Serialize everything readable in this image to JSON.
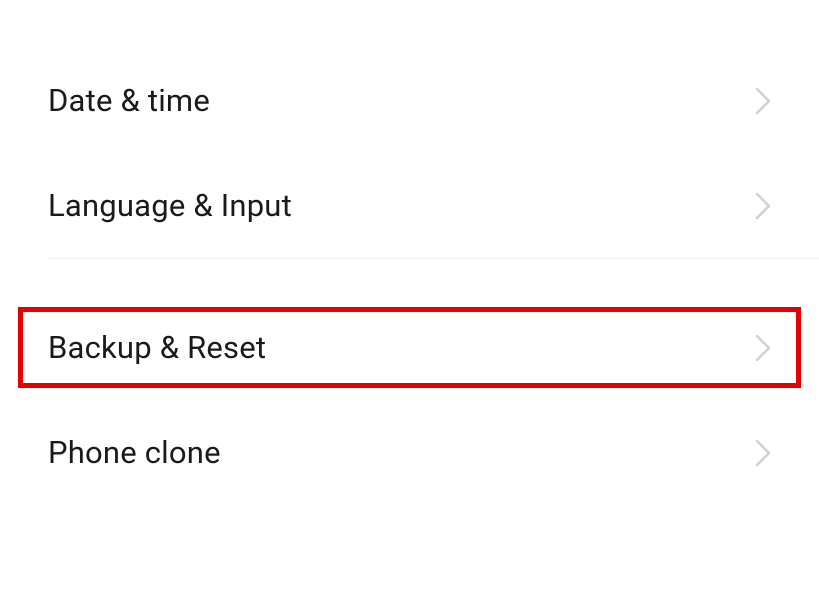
{
  "settings": {
    "group1": [
      {
        "id": "date-time",
        "label": "Date & time"
      },
      {
        "id": "language-input",
        "label": "Language & Input"
      }
    ],
    "group2": [
      {
        "id": "backup-reset",
        "label": "Backup & Reset",
        "highlighted": true
      },
      {
        "id": "phone-clone",
        "label": "Phone clone"
      }
    ]
  },
  "colors": {
    "highlight": "#e60000",
    "text": "#1a1a1a",
    "chevron": "#d0d0d0"
  }
}
